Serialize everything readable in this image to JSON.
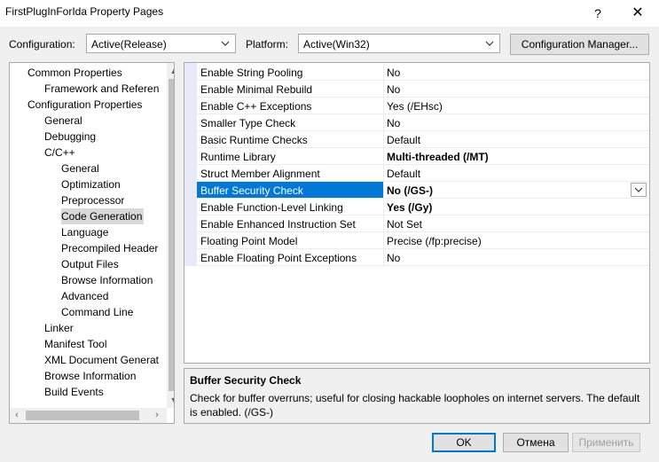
{
  "window": {
    "title": "FirstPlugInForIda Property Pages",
    "help_label": "?",
    "close_label": "✕"
  },
  "toolbar": {
    "configuration_label": "Configuration:",
    "configuration_value": "Active(Release)",
    "platform_label": "Platform:",
    "platform_value": "Active(Win32)",
    "config_manager_label": "Configuration Manager..."
  },
  "tree": {
    "items": [
      {
        "label": "Common Properties",
        "indent": 1
      },
      {
        "label": "Framework and Referen",
        "indent": 2
      },
      {
        "label": "Configuration Properties",
        "indent": 1
      },
      {
        "label": "General",
        "indent": 2
      },
      {
        "label": "Debugging",
        "indent": 2
      },
      {
        "label": "C/C++",
        "indent": 2
      },
      {
        "label": "General",
        "indent": 3
      },
      {
        "label": "Optimization",
        "indent": 3
      },
      {
        "label": "Preprocessor",
        "indent": 3
      },
      {
        "label": "Code Generation",
        "indent": 3,
        "selected": true
      },
      {
        "label": "Language",
        "indent": 3
      },
      {
        "label": "Precompiled Header",
        "indent": 3
      },
      {
        "label": "Output Files",
        "indent": 3
      },
      {
        "label": "Browse Information",
        "indent": 3
      },
      {
        "label": "Advanced",
        "indent": 3
      },
      {
        "label": "Command Line",
        "indent": 3
      },
      {
        "label": "Linker",
        "indent": 2
      },
      {
        "label": "Manifest Tool",
        "indent": 2
      },
      {
        "label": "XML Document Generat",
        "indent": 2
      },
      {
        "label": "Browse Information",
        "indent": 2
      },
      {
        "label": "Build Events",
        "indent": 2
      }
    ]
  },
  "grid": {
    "rows": [
      {
        "name": "Enable String Pooling",
        "value": "No"
      },
      {
        "name": "Enable Minimal Rebuild",
        "value": "No"
      },
      {
        "name": "Enable C++ Exceptions",
        "value": "Yes (/EHsc)"
      },
      {
        "name": "Smaller Type Check",
        "value": "No"
      },
      {
        "name": "Basic Runtime Checks",
        "value": "Default"
      },
      {
        "name": "Runtime Library",
        "value": "Multi-threaded (/MT)",
        "bold": true
      },
      {
        "name": "Struct Member Alignment",
        "value": "Default"
      },
      {
        "name": "Buffer Security Check",
        "value": "No (/GS-)",
        "bold": true,
        "selected": true
      },
      {
        "name": "Enable Function-Level Linking",
        "value": "Yes (/Gy)",
        "bold": true
      },
      {
        "name": "Enable Enhanced Instruction Set",
        "value": "Not Set"
      },
      {
        "name": "Floating Point Model",
        "value": "Precise (/fp:precise)"
      },
      {
        "name": "Enable Floating Point Exceptions",
        "value": "No"
      }
    ]
  },
  "description": {
    "title": "Buffer Security Check",
    "text": "Check for buffer overruns; useful for closing hackable loopholes on internet servers.  The default is enabled.    (/GS-)"
  },
  "buttons": {
    "ok": "OK",
    "cancel": "Отмена",
    "apply": "Применить"
  },
  "colors": {
    "selection": "#0078d7",
    "gutter": "#e8ebf7"
  }
}
